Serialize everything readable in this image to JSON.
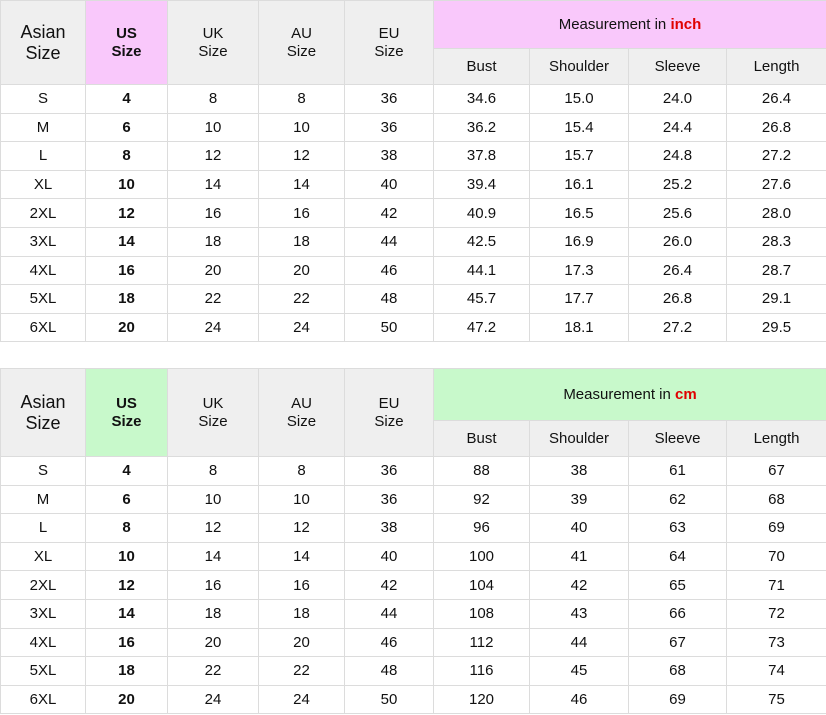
{
  "headers": {
    "asian": [
      "Asian",
      "Size"
    ],
    "us": [
      "US",
      "Size"
    ],
    "uk": [
      "UK",
      "Size"
    ],
    "au": [
      "AU",
      "Size"
    ],
    "eu": [
      "EU",
      "Size"
    ],
    "measurement_prefix": "Measurement in",
    "measures": [
      "Bust",
      "Shoulder",
      "Sleeve",
      "Length"
    ]
  },
  "tables": [
    {
      "unit": "inch",
      "rows": [
        [
          "S",
          "4",
          "8",
          "8",
          "36",
          "34.6",
          "15.0",
          "24.0",
          "26.4"
        ],
        [
          "M",
          "6",
          "10",
          "10",
          "36",
          "36.2",
          "15.4",
          "24.4",
          "26.8"
        ],
        [
          "L",
          "8",
          "12",
          "12",
          "38",
          "37.8",
          "15.7",
          "24.8",
          "27.2"
        ],
        [
          "XL",
          "10",
          "14",
          "14",
          "40",
          "39.4",
          "16.1",
          "25.2",
          "27.6"
        ],
        [
          "2XL",
          "12",
          "16",
          "16",
          "42",
          "40.9",
          "16.5",
          "25.6",
          "28.0"
        ],
        [
          "3XL",
          "14",
          "18",
          "18",
          "44",
          "42.5",
          "16.9",
          "26.0",
          "28.3"
        ],
        [
          "4XL",
          "16",
          "20",
          "20",
          "46",
          "44.1",
          "17.3",
          "26.4",
          "28.7"
        ],
        [
          "5XL",
          "18",
          "22",
          "22",
          "48",
          "45.7",
          "17.7",
          "26.8",
          "29.1"
        ],
        [
          "6XL",
          "20",
          "24",
          "24",
          "50",
          "47.2",
          "18.1",
          "27.2",
          "29.5"
        ]
      ]
    },
    {
      "unit": "cm",
      "rows": [
        [
          "S",
          "4",
          "8",
          "8",
          "36",
          "88",
          "38",
          "61",
          "67"
        ],
        [
          "M",
          "6",
          "10",
          "10",
          "36",
          "92",
          "39",
          "62",
          "68"
        ],
        [
          "L",
          "8",
          "12",
          "12",
          "38",
          "96",
          "40",
          "63",
          "69"
        ],
        [
          "XL",
          "10",
          "14",
          "14",
          "40",
          "100",
          "41",
          "64",
          "70"
        ],
        [
          "2XL",
          "12",
          "16",
          "16",
          "42",
          "104",
          "42",
          "65",
          "71"
        ],
        [
          "3XL",
          "14",
          "18",
          "18",
          "44",
          "108",
          "43",
          "66",
          "72"
        ],
        [
          "4XL",
          "16",
          "20",
          "20",
          "46",
          "112",
          "44",
          "67",
          "73"
        ],
        [
          "5XL",
          "18",
          "22",
          "22",
          "48",
          "116",
          "45",
          "68",
          "74"
        ],
        [
          "6XL",
          "20",
          "24",
          "24",
          "50",
          "120",
          "46",
          "69",
          "75"
        ]
      ]
    }
  ],
  "colors": {
    "inch_highlight": "#f9c8fb",
    "cm_highlight": "#c8f9cb",
    "unit_text": "#e00000",
    "header_gray": "#efefef"
  }
}
